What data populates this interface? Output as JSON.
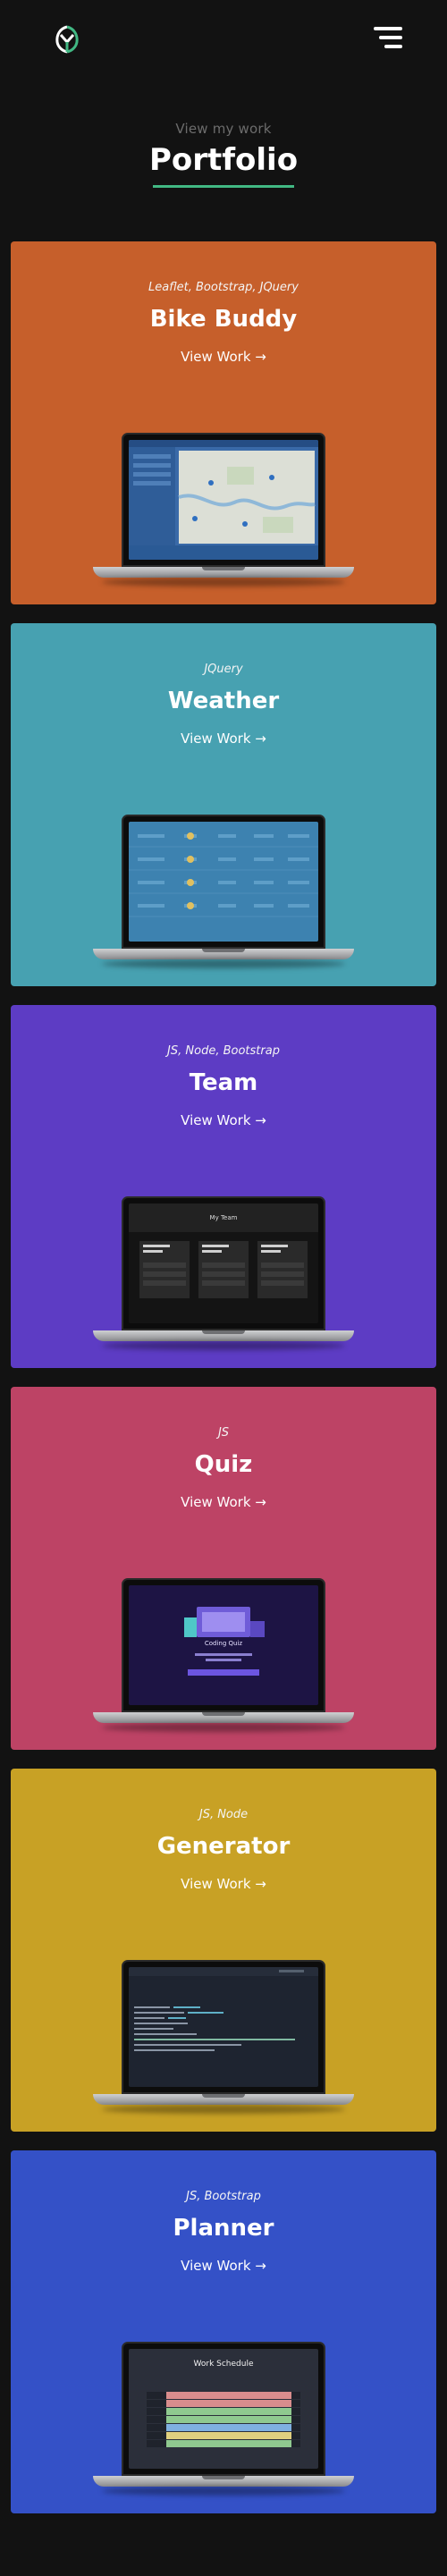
{
  "header": {
    "logo_icon": "leaf-monogram-logo",
    "menu_icon": "hamburger-menu-icon"
  },
  "intro": {
    "subtitle": "View my work",
    "title": "Portfolio"
  },
  "projects": [
    {
      "tech": "Leaflet, Bootstrap, JQuery",
      "name": "Bike Buddy",
      "link": "View Work →",
      "color": "#c65f2b"
    },
    {
      "tech": "JQuery",
      "name": "Weather",
      "link": "View Work →",
      "color": "#47a1b1"
    },
    {
      "tech": "JS, Node, Bootstrap",
      "name": "Team",
      "link": "View Work →",
      "color": "#5d3cc4"
    },
    {
      "tech": "JS",
      "name": "Quiz",
      "link": "View Work →",
      "color": "#bd4365"
    },
    {
      "tech": "JS, Node",
      "name": "Generator",
      "link": "View Work →",
      "color": "#c8a125"
    },
    {
      "tech": "JS, Bootstrap",
      "name": "Planner",
      "link": "View Work →",
      "color": "#3451c7"
    }
  ],
  "screens": {
    "team": {
      "header": "My Team"
    },
    "quiz": {
      "heading": "Coding Quiz"
    },
    "planner": {
      "header": "Work Schedule"
    }
  }
}
